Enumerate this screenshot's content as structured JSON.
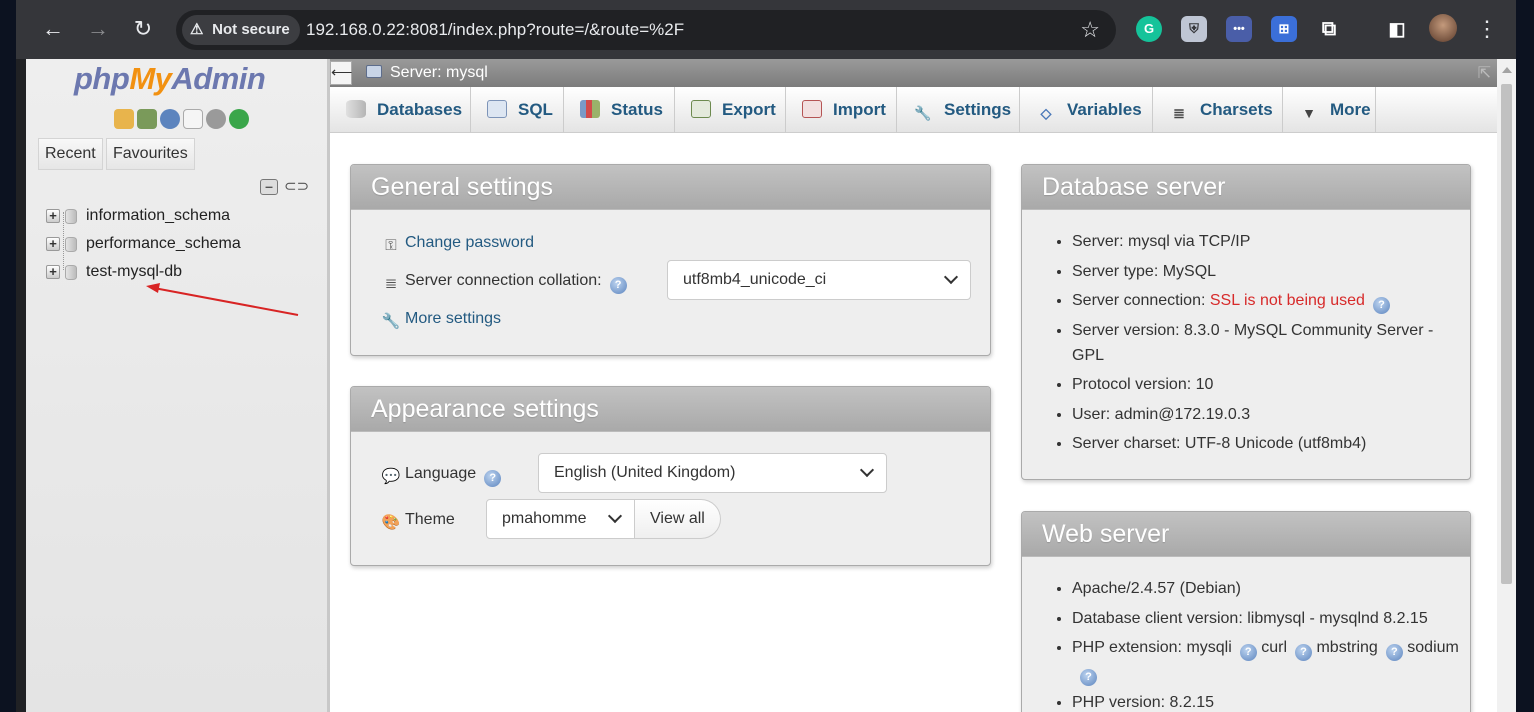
{
  "browser": {
    "security_label": "Not secure",
    "url": "192.168.0.22:8081/index.php?route=/&route=%2F"
  },
  "nav": {
    "logo": {
      "php": "php",
      "my": "My",
      "admin": "Admin"
    },
    "tabs": {
      "recent": "Recent",
      "favourites": "Favourites"
    },
    "databases": [
      "information_schema",
      "performance_schema",
      "test-mysql-db"
    ]
  },
  "serverbar": {
    "label": "Server: mysql"
  },
  "menu": {
    "tabs": [
      {
        "label": "Databases",
        "icon": "database-icon"
      },
      {
        "label": "SQL",
        "icon": "sql-icon"
      },
      {
        "label": "Status",
        "icon": "status-icon"
      },
      {
        "label": "Export",
        "icon": "export-icon"
      },
      {
        "label": "Import",
        "icon": "import-icon"
      },
      {
        "label": "Settings",
        "icon": "wrench-icon"
      },
      {
        "label": "Variables",
        "icon": "variables-icon"
      },
      {
        "label": "Charsets",
        "icon": "charsets-icon"
      },
      {
        "label": "More",
        "icon": "caret-down-icon"
      }
    ]
  },
  "general_settings": {
    "title": "General settings",
    "change_password": "Change password",
    "collation_label": "Server connection collation:",
    "collation_value": "utf8mb4_unicode_ci",
    "more_settings": "More settings"
  },
  "appearance_settings": {
    "title": "Appearance settings",
    "language_label": "Language",
    "language_value": "English (United Kingdom)",
    "theme_label": "Theme",
    "theme_value": "pmahomme",
    "view_all": "View all"
  },
  "database_server": {
    "title": "Database server",
    "items": {
      "server": "Server: mysql via TCP/IP",
      "type": "Server type: MySQL",
      "connection_label": "Server connection: ",
      "connection_value": "SSL is not being used",
      "version": "Server version: 8.3.0 - MySQL Community Server - GPL",
      "protocol": "Protocol version: 10",
      "user": "User: admin@172.19.0.3",
      "charset": "Server charset: UTF-8 Unicode (utf8mb4)"
    }
  },
  "web_server": {
    "title": "Web server",
    "items": {
      "apache": "Apache/2.4.57 (Debian)",
      "client": "Database client version: libmysql - mysqlnd 8.2.15",
      "ext_label": "PHP extension: ",
      "ext_mysqli": "mysqli",
      "ext_curl": "curl",
      "ext_mbstring": "mbstring",
      "ext_sodium": "sodium",
      "php_version": "PHP version: 8.2.15"
    }
  },
  "colors": {
    "link": "#235a81",
    "warning": "#d72a2a",
    "box_header": "#a9a9a9",
    "logo_blue": "#6c78af",
    "logo_orange": "#f29111",
    "annotation_arrow": "#d82424"
  }
}
